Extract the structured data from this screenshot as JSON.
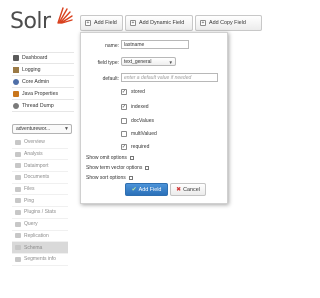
{
  "app": {
    "logo_text": "Solr"
  },
  "sidebar": {
    "items": [
      {
        "label": "Dashboard",
        "icon": "dashboard-icon"
      },
      {
        "label": "Logging",
        "icon": "logging-icon"
      },
      {
        "label": "Core Admin",
        "icon": "core-admin-icon"
      },
      {
        "label": "Java Properties",
        "icon": "java-properties-icon"
      },
      {
        "label": "Thread Dump",
        "icon": "thread-dump-icon"
      }
    ],
    "core_selector": {
      "value": "adventurewor..."
    },
    "core_items": [
      {
        "label": "Overview"
      },
      {
        "label": "Analysis"
      },
      {
        "label": "Dataimport"
      },
      {
        "label": "Documents"
      },
      {
        "label": "Files"
      },
      {
        "label": "Ping"
      },
      {
        "label": "Plugins / Stats"
      },
      {
        "label": "Query"
      },
      {
        "label": "Replication"
      },
      {
        "label": "Schema"
      },
      {
        "label": "Segments info"
      }
    ]
  },
  "toolbar": {
    "add_field": "Add Field",
    "add_dynamic_field": "Add Dynamic Field",
    "add_copy_field": "Add Copy Field"
  },
  "dialog": {
    "name_label": "name:",
    "name_value": "lastname",
    "field_type_label": "field type:",
    "field_type_value": "text_general",
    "default_label": "default:",
    "default_placeholder": "enter a default value if needed",
    "checkboxes": [
      {
        "label": "stored",
        "checked": true
      },
      {
        "label": "indexed",
        "checked": true
      },
      {
        "label": "docValues",
        "checked": false
      },
      {
        "label": "multiValued",
        "checked": false
      },
      {
        "label": "required",
        "checked": true
      }
    ],
    "show_omit": "Show omit options",
    "show_term_vector": "Show term vector options",
    "show_sort": "Show sort options",
    "add_button": "Add Field",
    "cancel_button": "Cancel"
  },
  "colors": {
    "primary_button": "#2a70b9",
    "logo_accent": "#d9411e",
    "cancel_icon": "#d03838"
  }
}
